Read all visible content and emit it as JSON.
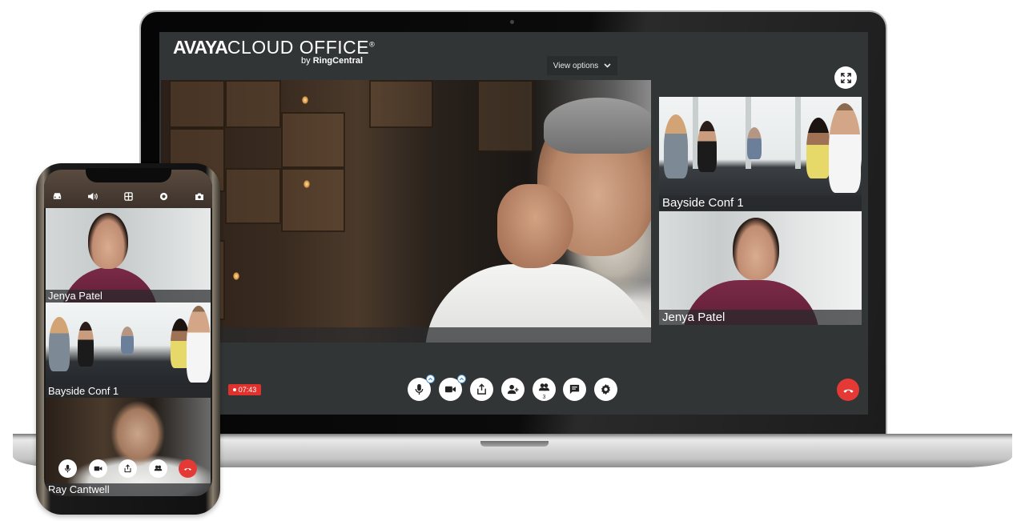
{
  "app": {
    "brand": "AVAYA",
    "product": "CLOUD OFFICE",
    "registered_mark": "®",
    "subtitle_prefix": "by",
    "subtitle_brand": "RingCentral"
  },
  "toolbar": {
    "view_options_label": "View options",
    "expand_icon": "expand-icon"
  },
  "main_video": {
    "participant_name_visible": "well"
  },
  "side_tiles": [
    {
      "name": "Bayside Conf 1"
    },
    {
      "name": "Jenya Patel"
    }
  ],
  "recording": {
    "elapsed": "07:43",
    "color": "#e0312d"
  },
  "controls": [
    {
      "id": "microphone",
      "icon": "microphone-icon",
      "has_options_caret": true
    },
    {
      "id": "video",
      "icon": "video-camera-icon",
      "has_options_caret": true
    },
    {
      "id": "share",
      "icon": "share-screen-icon",
      "has_options_caret": false
    },
    {
      "id": "invite",
      "icon": "add-participant-icon",
      "has_options_caret": false
    },
    {
      "id": "participants",
      "icon": "participants-icon",
      "count": "3",
      "has_options_caret": false
    },
    {
      "id": "chat",
      "icon": "chat-icon",
      "has_options_caret": false
    },
    {
      "id": "settings",
      "icon": "gear-icon",
      "has_options_caret": false
    }
  ],
  "end_call": {
    "icon": "hang-up-icon",
    "color": "#e53935"
  },
  "phone": {
    "top_icons": [
      "car-mode-icon",
      "speaker-icon",
      "grid-view-icon",
      "record-icon",
      "camera-flip-icon"
    ],
    "tiles": [
      {
        "name": "Jenya Patel"
      },
      {
        "name": "Bayside Conf 1"
      },
      {
        "name": "Ray Cantwell"
      }
    ],
    "controls": [
      "microphone-icon",
      "video-camera-icon",
      "share-screen-icon",
      "participants-icon",
      "hang-up-icon"
    ]
  },
  "colors": {
    "screen_background": "#313536",
    "accent_caret": "#4a90c9",
    "end_call_red": "#e53935"
  }
}
